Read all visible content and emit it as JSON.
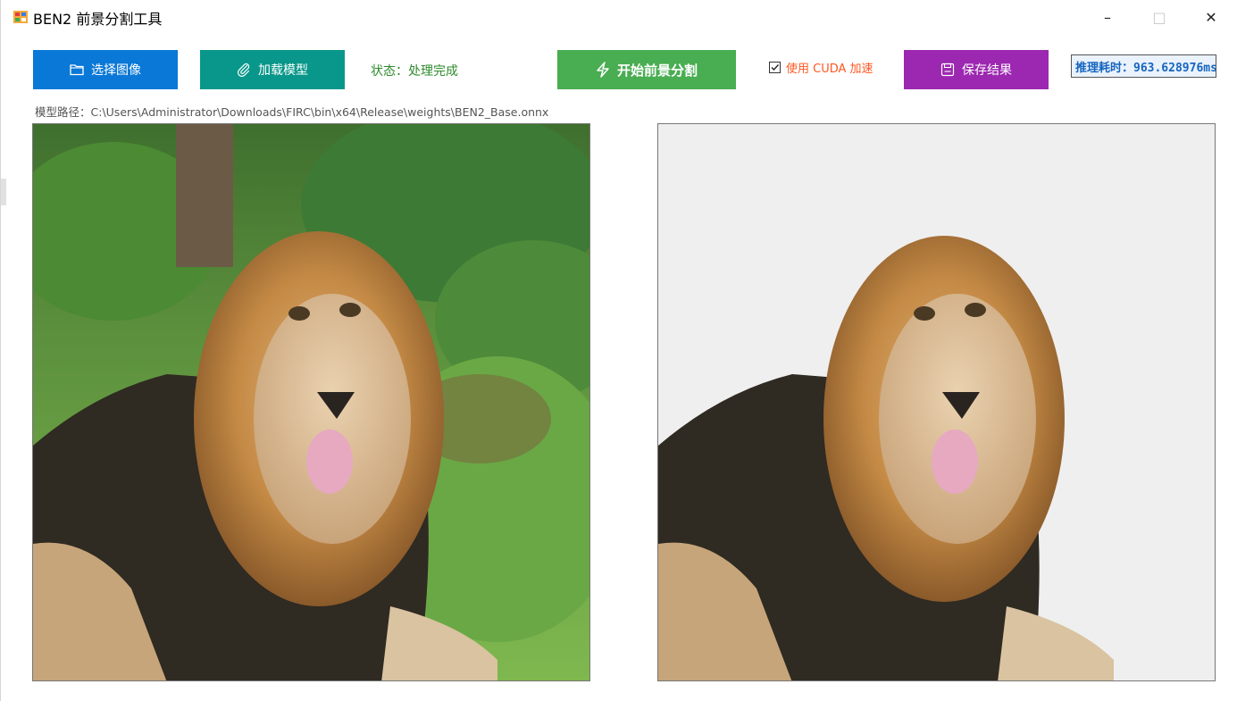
{
  "window": {
    "title": "BEN2 前景分割工具",
    "controls": {
      "minimize": "–",
      "maximize": "□",
      "close": "✕"
    }
  },
  "toolbar": {
    "select_image": {
      "label": "选择图像",
      "icon": "folder-icon",
      "color": "#0a78d7"
    },
    "load_model": {
      "label": "加载模型",
      "icon": "paperclip-icon",
      "color": "#08978a"
    },
    "status": "状态：处理完成",
    "start_segmentation": {
      "label": "开始前景分割",
      "icon": "lightning-icon",
      "color": "#49ad52"
    },
    "cuda": {
      "label": "使用 CUDA 加速",
      "checked": true
    },
    "save_result": {
      "label": "保存结果",
      "icon": "save-icon",
      "color": "#9c27b0"
    },
    "inference_time": "推理耗时：963.628976ms"
  },
  "model_path": "模型路径：C:\\Users\\Administrator\\Downloads\\FIRC\\bin\\x64\\Release\\weights\\BEN2_Base.onnx",
  "panels": {
    "source": {
      "image": "lion on grass photo"
    },
    "result": {
      "image": "segmented lion foreground",
      "background_color": "#efefef"
    }
  }
}
